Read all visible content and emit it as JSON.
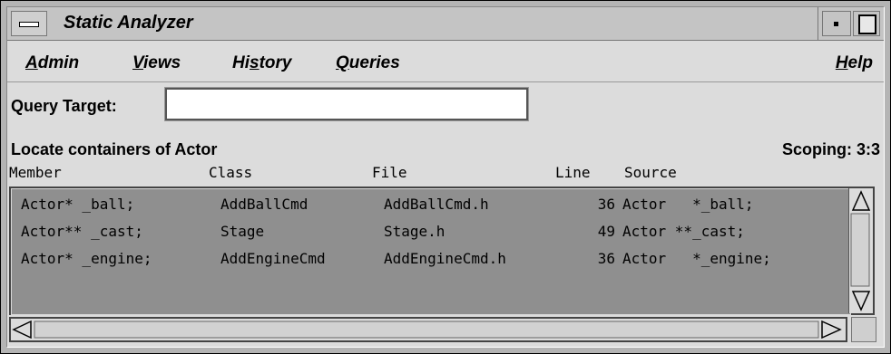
{
  "window": {
    "title": "Static Analyzer"
  },
  "menubar": {
    "admin": {
      "mnemonic": "A",
      "rest": "dmin"
    },
    "views": {
      "mnemonic": "V",
      "rest": "iews"
    },
    "history": {
      "pre": "Hi",
      "mnemonic": "s",
      "rest": "tory"
    },
    "queries": {
      "mnemonic": "Q",
      "rest": "ueries"
    },
    "help": {
      "mnemonic": "H",
      "rest": "elp"
    }
  },
  "query": {
    "label": "Query Target:",
    "value": ""
  },
  "status": {
    "locate": "Locate containers of Actor",
    "scoping": "Scoping: 3:3"
  },
  "columns": {
    "member": "Member",
    "class": "Class",
    "file": "File",
    "line": "Line",
    "source": "Source"
  },
  "rows": [
    {
      "member": "Actor* _ball;",
      "class": "AddBallCmd",
      "file": "AddBallCmd.h",
      "line": "36",
      "source": "Actor   *_ball;"
    },
    {
      "member": "Actor** _cast;",
      "class": "Stage",
      "file": "Stage.h",
      "line": "49",
      "source": "Actor **_cast;"
    },
    {
      "member": "Actor* _engine;",
      "class": "AddEngineCmd",
      "file": "AddEngineCmd.h",
      "line": "36",
      "source": "Actor   *_engine;"
    }
  ],
  "colors": {
    "list_bg": "#8f8f8f",
    "panel_bg": "#dcdcdc"
  }
}
